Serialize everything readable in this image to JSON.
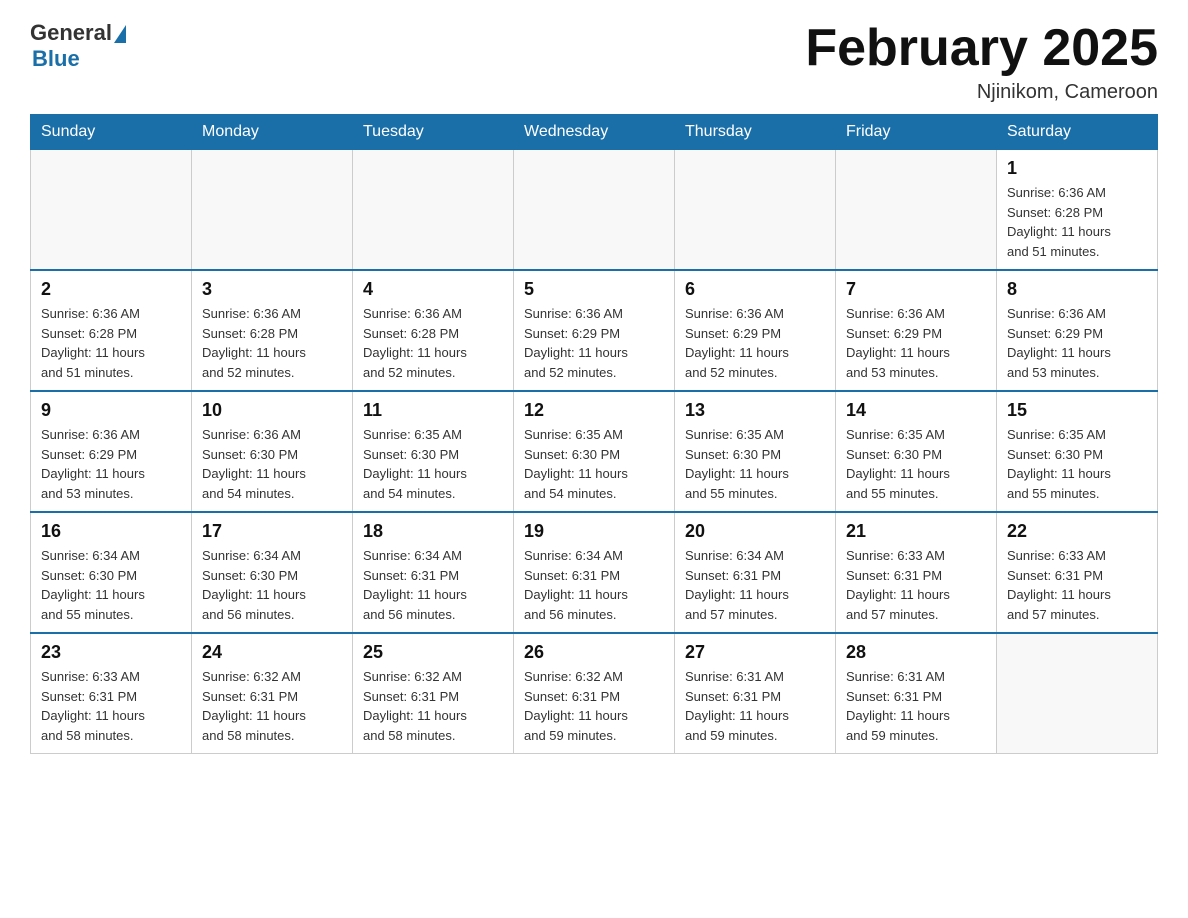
{
  "header": {
    "logo_general": "General",
    "logo_blue": "Blue",
    "month_title": "February 2025",
    "location": "Njinikom, Cameroon"
  },
  "weekdays": [
    "Sunday",
    "Monday",
    "Tuesday",
    "Wednesday",
    "Thursday",
    "Friday",
    "Saturday"
  ],
  "weeks": [
    [
      {
        "day": "",
        "info": ""
      },
      {
        "day": "",
        "info": ""
      },
      {
        "day": "",
        "info": ""
      },
      {
        "day": "",
        "info": ""
      },
      {
        "day": "",
        "info": ""
      },
      {
        "day": "",
        "info": ""
      },
      {
        "day": "1",
        "info": "Sunrise: 6:36 AM\nSunset: 6:28 PM\nDaylight: 11 hours\nand 51 minutes."
      }
    ],
    [
      {
        "day": "2",
        "info": "Sunrise: 6:36 AM\nSunset: 6:28 PM\nDaylight: 11 hours\nand 51 minutes."
      },
      {
        "day": "3",
        "info": "Sunrise: 6:36 AM\nSunset: 6:28 PM\nDaylight: 11 hours\nand 52 minutes."
      },
      {
        "day": "4",
        "info": "Sunrise: 6:36 AM\nSunset: 6:28 PM\nDaylight: 11 hours\nand 52 minutes."
      },
      {
        "day": "5",
        "info": "Sunrise: 6:36 AM\nSunset: 6:29 PM\nDaylight: 11 hours\nand 52 minutes."
      },
      {
        "day": "6",
        "info": "Sunrise: 6:36 AM\nSunset: 6:29 PM\nDaylight: 11 hours\nand 52 minutes."
      },
      {
        "day": "7",
        "info": "Sunrise: 6:36 AM\nSunset: 6:29 PM\nDaylight: 11 hours\nand 53 minutes."
      },
      {
        "day": "8",
        "info": "Sunrise: 6:36 AM\nSunset: 6:29 PM\nDaylight: 11 hours\nand 53 minutes."
      }
    ],
    [
      {
        "day": "9",
        "info": "Sunrise: 6:36 AM\nSunset: 6:29 PM\nDaylight: 11 hours\nand 53 minutes."
      },
      {
        "day": "10",
        "info": "Sunrise: 6:36 AM\nSunset: 6:30 PM\nDaylight: 11 hours\nand 54 minutes."
      },
      {
        "day": "11",
        "info": "Sunrise: 6:35 AM\nSunset: 6:30 PM\nDaylight: 11 hours\nand 54 minutes."
      },
      {
        "day": "12",
        "info": "Sunrise: 6:35 AM\nSunset: 6:30 PM\nDaylight: 11 hours\nand 54 minutes."
      },
      {
        "day": "13",
        "info": "Sunrise: 6:35 AM\nSunset: 6:30 PM\nDaylight: 11 hours\nand 55 minutes."
      },
      {
        "day": "14",
        "info": "Sunrise: 6:35 AM\nSunset: 6:30 PM\nDaylight: 11 hours\nand 55 minutes."
      },
      {
        "day": "15",
        "info": "Sunrise: 6:35 AM\nSunset: 6:30 PM\nDaylight: 11 hours\nand 55 minutes."
      }
    ],
    [
      {
        "day": "16",
        "info": "Sunrise: 6:34 AM\nSunset: 6:30 PM\nDaylight: 11 hours\nand 55 minutes."
      },
      {
        "day": "17",
        "info": "Sunrise: 6:34 AM\nSunset: 6:30 PM\nDaylight: 11 hours\nand 56 minutes."
      },
      {
        "day": "18",
        "info": "Sunrise: 6:34 AM\nSunset: 6:31 PM\nDaylight: 11 hours\nand 56 minutes."
      },
      {
        "day": "19",
        "info": "Sunrise: 6:34 AM\nSunset: 6:31 PM\nDaylight: 11 hours\nand 56 minutes."
      },
      {
        "day": "20",
        "info": "Sunrise: 6:34 AM\nSunset: 6:31 PM\nDaylight: 11 hours\nand 57 minutes."
      },
      {
        "day": "21",
        "info": "Sunrise: 6:33 AM\nSunset: 6:31 PM\nDaylight: 11 hours\nand 57 minutes."
      },
      {
        "day": "22",
        "info": "Sunrise: 6:33 AM\nSunset: 6:31 PM\nDaylight: 11 hours\nand 57 minutes."
      }
    ],
    [
      {
        "day": "23",
        "info": "Sunrise: 6:33 AM\nSunset: 6:31 PM\nDaylight: 11 hours\nand 58 minutes."
      },
      {
        "day": "24",
        "info": "Sunrise: 6:32 AM\nSunset: 6:31 PM\nDaylight: 11 hours\nand 58 minutes."
      },
      {
        "day": "25",
        "info": "Sunrise: 6:32 AM\nSunset: 6:31 PM\nDaylight: 11 hours\nand 58 minutes."
      },
      {
        "day": "26",
        "info": "Sunrise: 6:32 AM\nSunset: 6:31 PM\nDaylight: 11 hours\nand 59 minutes."
      },
      {
        "day": "27",
        "info": "Sunrise: 6:31 AM\nSunset: 6:31 PM\nDaylight: 11 hours\nand 59 minutes."
      },
      {
        "day": "28",
        "info": "Sunrise: 6:31 AM\nSunset: 6:31 PM\nDaylight: 11 hours\nand 59 minutes."
      },
      {
        "day": "",
        "info": ""
      }
    ]
  ]
}
